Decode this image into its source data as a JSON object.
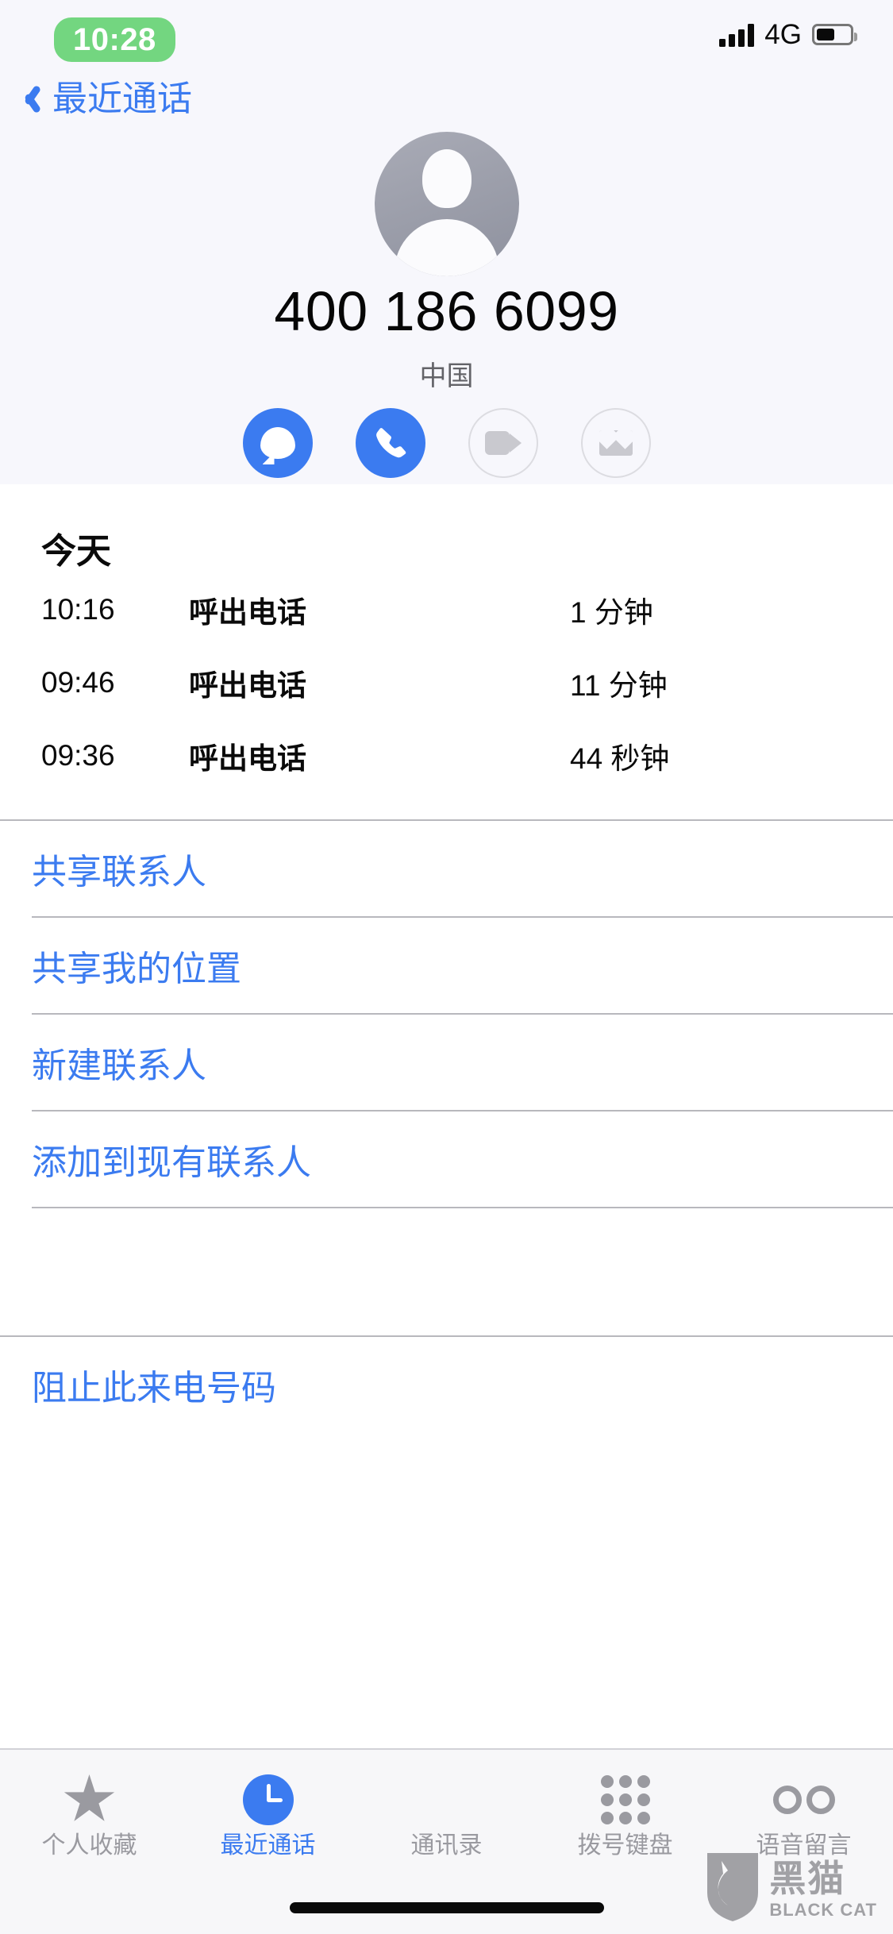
{
  "status_bar": {
    "time": "10:28",
    "network_label": "4G",
    "signal_icon": "signal-bars-icon",
    "battery_icon": "battery-icon",
    "time_pill_color": "#73d680"
  },
  "nav": {
    "back_label": "最近通话",
    "back_icon": "chevron-left-icon",
    "accent_color": "#3b7bf0"
  },
  "contact": {
    "avatar_icon": "person-placeholder-avatar",
    "phone_number": "400 186 6099",
    "region": "中国"
  },
  "actions": [
    {
      "label": "信息",
      "icon": "message-bubble-icon",
      "enabled": true
    },
    {
      "label": "呼叫",
      "icon": "phone-handset-icon",
      "enabled": true
    },
    {
      "label": "视频",
      "icon": "video-camera-icon",
      "enabled": false
    },
    {
      "label": "邮件",
      "icon": "envelope-icon",
      "enabled": false
    }
  ],
  "call_log": {
    "header": "今天",
    "rows": [
      {
        "time": "10:16",
        "type": "呼出电话",
        "duration": "1 分钟"
      },
      {
        "time": "09:46",
        "type": "呼出电话",
        "duration": "11 分钟"
      },
      {
        "time": "09:36",
        "type": "呼出电话",
        "duration": "44 秒钟"
      }
    ]
  },
  "link_actions": [
    {
      "label": "共享联系人"
    },
    {
      "label": "共享我的位置"
    },
    {
      "label": "新建联系人"
    },
    {
      "label": "添加到现有联系人"
    }
  ],
  "block_action": {
    "label": "阻止此来电号码"
  },
  "tabbar": [
    {
      "label": "个人收藏",
      "icon": "star-icon",
      "active": false
    },
    {
      "label": "最近通话",
      "icon": "clock-icon",
      "active": true
    },
    {
      "label": "通讯录",
      "icon": "people-icon",
      "active": false
    },
    {
      "label": "拨号键盘",
      "icon": "keypad-icon",
      "active": false
    },
    {
      "label": "语音留言",
      "icon": "voicemail-icon",
      "active": false
    }
  ],
  "watermark": {
    "cn": "黑猫",
    "en": "BLACK CAT",
    "icon": "black-cat-shield-logo"
  }
}
